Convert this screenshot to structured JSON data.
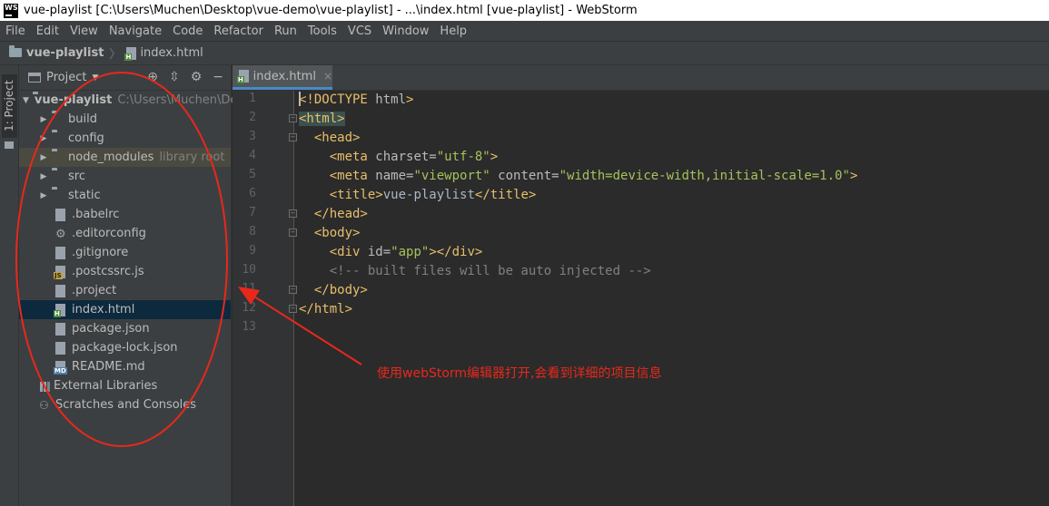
{
  "window": {
    "title": "vue-playlist [C:\\Users\\Muchen\\Desktop\\vue-demo\\vue-playlist] - ...\\index.html [vue-playlist] - WebStorm",
    "logo_text": "WS"
  },
  "menu": [
    "File",
    "Edit",
    "View",
    "Navigate",
    "Code",
    "Refactor",
    "Run",
    "Tools",
    "VCS",
    "Window",
    "Help"
  ],
  "navbar": {
    "project": "vue-playlist",
    "file": "index.html"
  },
  "stripe": {
    "project_label": "1: Project"
  },
  "project_panel": {
    "title": "Project",
    "tree": [
      {
        "label": "vue-playlist",
        "secondary": "C:\\Users\\Muchen\\De",
        "kind": "folder",
        "depth": 0,
        "expanded": true,
        "bold": true
      },
      {
        "label": "build",
        "kind": "folder",
        "depth": 1,
        "expanded": false
      },
      {
        "label": "config",
        "kind": "folder",
        "depth": 1,
        "expanded": false
      },
      {
        "label": "node_modules",
        "secondary": "library root",
        "kind": "folder",
        "depth": 1,
        "expanded": false
      },
      {
        "label": "src",
        "kind": "folder",
        "depth": 1,
        "expanded": false
      },
      {
        "label": "static",
        "kind": "folder",
        "depth": 1,
        "expanded": false
      },
      {
        "label": ".babelrc",
        "kind": "file",
        "depth": 1
      },
      {
        "label": ".editorconfig",
        "kind": "config",
        "depth": 1
      },
      {
        "label": ".gitignore",
        "kind": "file",
        "depth": 1
      },
      {
        "label": ".postcssrc.js",
        "kind": "js",
        "depth": 1
      },
      {
        "label": ".project",
        "kind": "file",
        "depth": 1
      },
      {
        "label": "index.html",
        "kind": "html",
        "depth": 1,
        "selected": true
      },
      {
        "label": "package.json",
        "kind": "file",
        "depth": 1
      },
      {
        "label": "package-lock.json",
        "kind": "file",
        "depth": 1
      },
      {
        "label": "README.md",
        "kind": "md",
        "depth": 1
      },
      {
        "label": "External Libraries",
        "kind": "lib",
        "depth": 0
      },
      {
        "label": "Scratches and Consoles",
        "kind": "scratch",
        "depth": 0
      }
    ]
  },
  "editor": {
    "tab": {
      "label": "index.html",
      "close": "×"
    },
    "line_numbers": [
      "1",
      "2",
      "3",
      "4",
      "5",
      "6",
      "7",
      "8",
      "9",
      "10",
      "11",
      "12",
      "13"
    ]
  },
  "annotation": {
    "text": "使用webStorm编辑器打开,会看到详细的项目信息",
    "color": "#e8281c"
  }
}
